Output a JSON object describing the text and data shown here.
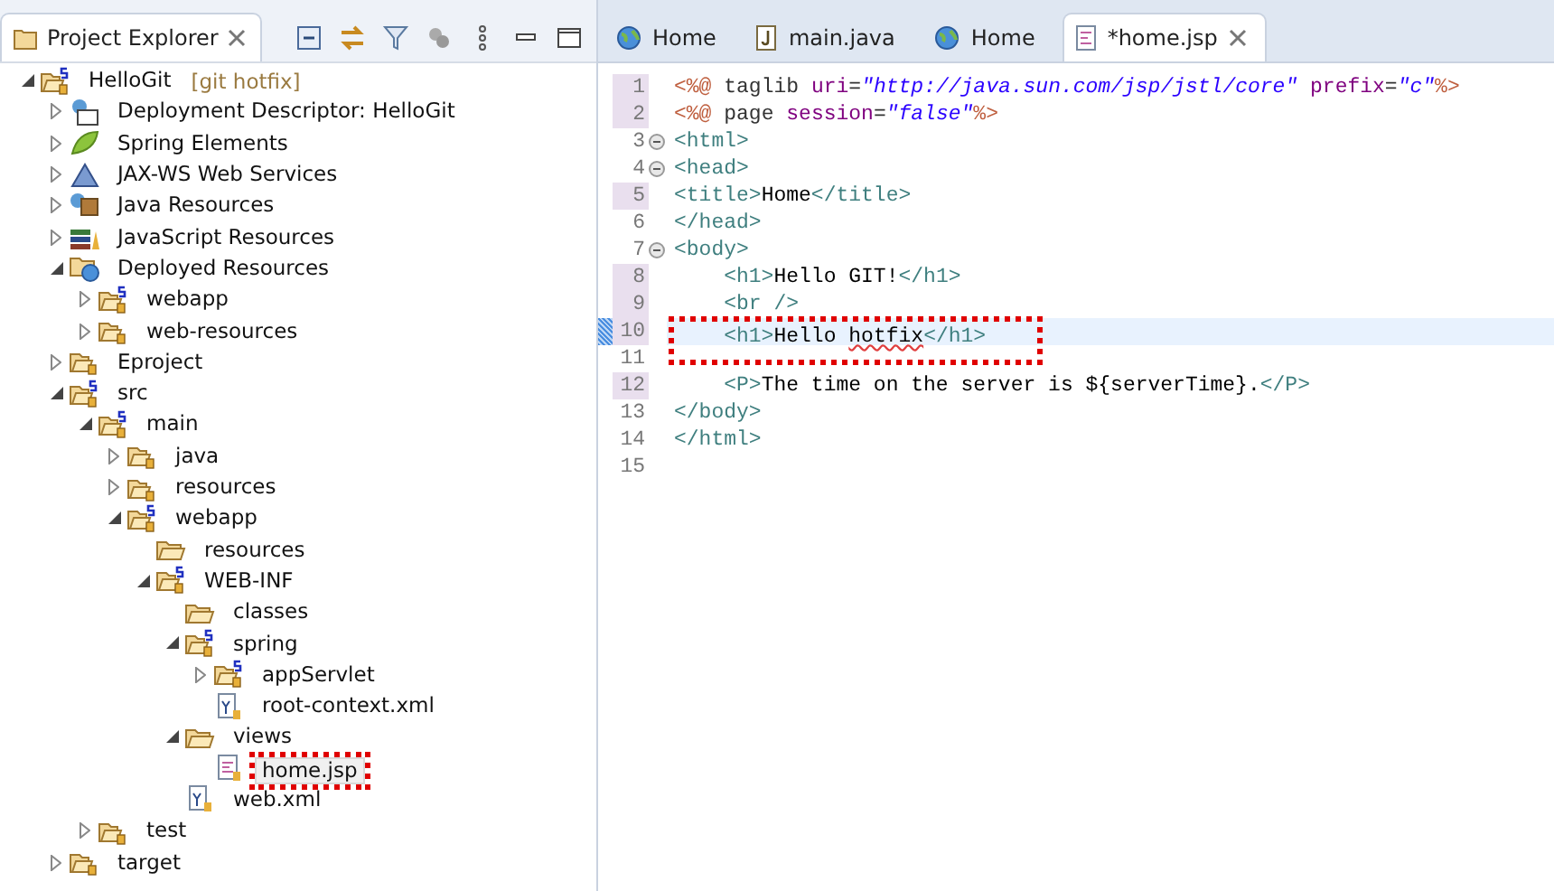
{
  "explorer": {
    "title": "Project Explorer",
    "tree": [
      {
        "label": "HelloGit",
        "suffix": "[git hotfix]",
        "kind": "project",
        "expanded": true,
        "selected": false,
        "children": [
          {
            "label": "Deployment Descriptor: HelloGit",
            "kind": "descriptor",
            "expanded": false,
            "selected": false
          },
          {
            "label": "Spring Elements",
            "kind": "leaf",
            "expanded": false,
            "selected": false
          },
          {
            "label": "JAX-WS Web Services",
            "kind": "webservice",
            "expanded": false,
            "selected": false
          },
          {
            "label": "Java Resources",
            "kind": "javares",
            "expanded": false,
            "selected": false
          },
          {
            "label": "JavaScript Resources",
            "kind": "books",
            "expanded": false,
            "selected": false
          },
          {
            "label": "Deployed Resources",
            "kind": "deployed",
            "expanded": true,
            "selected": false,
            "children": [
              {
                "label": "webapp",
                "kind": "springfolder",
                "expanded": false,
                "selected": false
              },
              {
                "label": "web-resources",
                "kind": "folder",
                "expanded": false,
                "selected": false
              }
            ]
          },
          {
            "label": "Eproject",
            "kind": "folder",
            "expanded": false,
            "selected": false
          },
          {
            "label": "src",
            "kind": "springfolder",
            "expanded": true,
            "selected": false,
            "children": [
              {
                "label": "main",
                "kind": "springfolder",
                "expanded": true,
                "selected": false,
                "children": [
                  {
                    "label": "java",
                    "kind": "folder",
                    "expanded": false,
                    "selected": false
                  },
                  {
                    "label": "resources",
                    "kind": "folder",
                    "expanded": false,
                    "selected": false
                  },
                  {
                    "label": "webapp",
                    "kind": "springfolder",
                    "expanded": true,
                    "selected": false,
                    "children": [
                      {
                        "label": "resources",
                        "kind": "plainfolder",
                        "selected": false
                      },
                      {
                        "label": "WEB-INF",
                        "kind": "springfolder",
                        "expanded": true,
                        "selected": false,
                        "children": [
                          {
                            "label": "classes",
                            "kind": "plainfolder",
                            "selected": false
                          },
                          {
                            "label": "spring",
                            "kind": "springfolder",
                            "expanded": true,
                            "selected": false,
                            "children": [
                              {
                                "label": "appServlet",
                                "kind": "springfolder",
                                "expanded": false,
                                "selected": false
                              },
                              {
                                "label": "root-context.xml",
                                "kind": "xml",
                                "selected": false
                              }
                            ]
                          },
                          {
                            "label": "views",
                            "kind": "plainfolder",
                            "expanded": true,
                            "selected": false,
                            "children": [
                              {
                                "label": "home.jsp",
                                "kind": "jsp",
                                "selected": true,
                                "highlighted": true
                              }
                            ]
                          },
                          {
                            "label": "web.xml",
                            "kind": "xml",
                            "selected": false
                          }
                        ]
                      }
                    ]
                  }
                ]
              },
              {
                "label": "test",
                "kind": "folder",
                "expanded": false,
                "selected": false
              }
            ]
          },
          {
            "label": "target",
            "kind": "folder",
            "expanded": false,
            "selected": false
          }
        ]
      }
    ]
  },
  "editor": {
    "tabs": [
      {
        "label": "Home",
        "kind": "globe",
        "selected": false
      },
      {
        "label": "main.java",
        "kind": "java",
        "selected": false
      },
      {
        "label": "Home",
        "kind": "globe",
        "selected": false
      },
      {
        "label": "*home.jsp",
        "kind": "jsp",
        "selected": true
      }
    ],
    "lines": [
      {
        "number": "1",
        "changed": true,
        "foldable": false,
        "current": false,
        "tokens": [
          {
            "kind": "directive",
            "text": "<%@"
          },
          {
            "kind": "plain",
            "text": " taglib "
          },
          {
            "kind": "attr",
            "text": "uri"
          },
          {
            "kind": "plain",
            "text": "="
          },
          {
            "kind": "string",
            "text": "\"http://java.sun.com/jsp/jstl/core\""
          },
          {
            "kind": "attr",
            "text": " prefix"
          },
          {
            "kind": "plain",
            "text": "="
          },
          {
            "kind": "string",
            "text": "\"c\""
          },
          {
            "kind": "directive",
            "text": "%>"
          }
        ]
      },
      {
        "number": "2",
        "changed": true,
        "foldable": false,
        "current": false,
        "tokens": [
          {
            "kind": "directive",
            "text": "<%@"
          },
          {
            "kind": "plain",
            "text": " page "
          },
          {
            "kind": "attr",
            "text": "session"
          },
          {
            "kind": "plain",
            "text": "="
          },
          {
            "kind": "string",
            "text": "\"false\""
          },
          {
            "kind": "directive",
            "text": "%>"
          }
        ]
      },
      {
        "number": "3",
        "changed": false,
        "foldable": true,
        "current": false,
        "tokens": [
          {
            "kind": "tag",
            "text": "<html>"
          }
        ]
      },
      {
        "number": "4",
        "changed": false,
        "foldable": true,
        "current": false,
        "tokens": [
          {
            "kind": "tag",
            "text": "<head>"
          }
        ]
      },
      {
        "number": "5",
        "changed": true,
        "foldable": false,
        "current": false,
        "tokens": [
          {
            "kind": "tag",
            "text": "<title>"
          },
          {
            "kind": "text",
            "text": "Home"
          },
          {
            "kind": "tag",
            "text": "</title>"
          }
        ]
      },
      {
        "number": "6",
        "changed": false,
        "foldable": false,
        "current": false,
        "tokens": [
          {
            "kind": "tag",
            "text": "</head>"
          }
        ]
      },
      {
        "number": "7",
        "changed": false,
        "foldable": true,
        "current": false,
        "tokens": [
          {
            "kind": "tag",
            "text": "<body>"
          }
        ]
      },
      {
        "number": "8",
        "changed": true,
        "foldable": false,
        "current": false,
        "tokens": [
          {
            "kind": "tag",
            "text": "    <h1>"
          },
          {
            "kind": "text",
            "text": "Hello GIT!"
          },
          {
            "kind": "tag",
            "text": "</h1>"
          }
        ]
      },
      {
        "number": "9",
        "changed": true,
        "foldable": false,
        "current": false,
        "tokens": [
          {
            "kind": "tag",
            "text": "    <br />"
          }
        ]
      },
      {
        "number": "10",
        "changed": true,
        "foldable": false,
        "current": true,
        "highlighted": true,
        "tokens": [
          {
            "kind": "tag",
            "text": "    <h1>"
          },
          {
            "kind": "text",
            "text": "Hello "
          },
          {
            "kind": "misspelled",
            "text": "hotfix"
          },
          {
            "kind": "tag",
            "text": "</h1>"
          }
        ]
      },
      {
        "number": "11",
        "changed": false,
        "foldable": false,
        "current": false
      },
      {
        "number": "12",
        "changed": true,
        "foldable": false,
        "current": false,
        "tokens": [
          {
            "kind": "tag",
            "text": "    <P>"
          },
          {
            "kind": "text",
            "text": "The time on the server is ${serverTime}."
          },
          {
            "kind": "tag",
            "text": "</P>"
          }
        ]
      },
      {
        "number": "13",
        "changed": false,
        "foldable": false,
        "current": false,
        "tokens": [
          {
            "kind": "tag",
            "text": "</body>"
          }
        ]
      },
      {
        "number": "14",
        "changed": false,
        "foldable": false,
        "current": false,
        "tokens": [
          {
            "kind": "tag",
            "text": "</html>"
          }
        ]
      },
      {
        "number": "15",
        "changed": false,
        "foldable": false,
        "current": false
      }
    ]
  }
}
